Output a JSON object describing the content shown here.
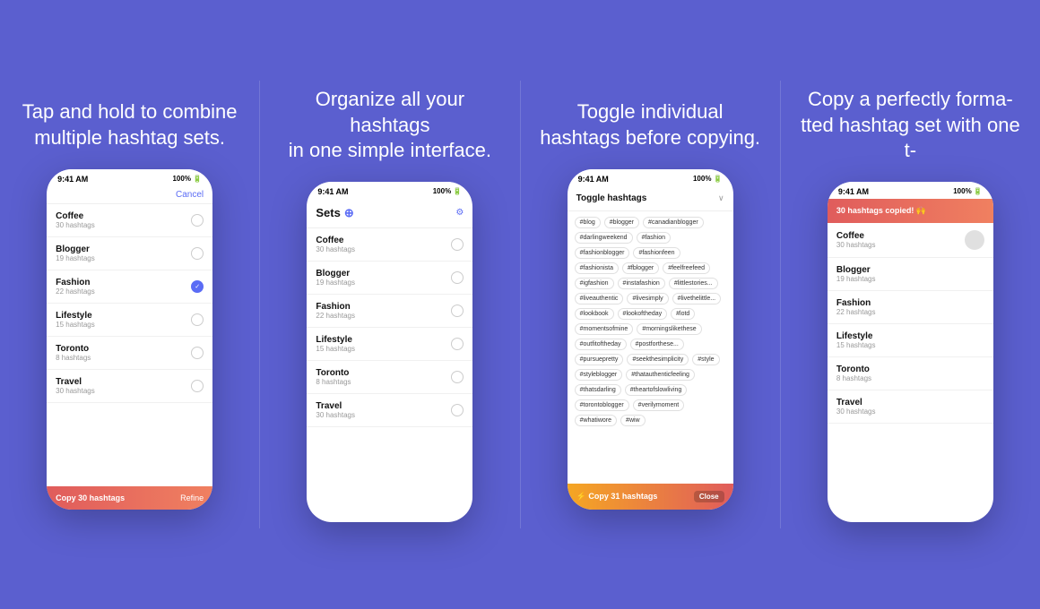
{
  "background_color": "#5b5fcf",
  "panels": [
    {
      "id": "panel-1",
      "description": "Tap and hold to combine multiple hashtag sets.",
      "phone": {
        "status_time": "9:41 AM",
        "status_battery": "100%",
        "header": {
          "cancel_label": "Cancel"
        },
        "list_items": [
          {
            "name": "Coffee",
            "count": "30 hashtags",
            "selected": false
          },
          {
            "name": "Blogger",
            "count": "19 hashtags",
            "selected": false
          },
          {
            "name": "Fashion",
            "count": "22 hashtags",
            "selected": true
          },
          {
            "name": "Lifestyle",
            "count": "15 hashtags",
            "selected": false
          },
          {
            "name": "Toronto",
            "count": "8 hashtags",
            "selected": false
          },
          {
            "name": "Travel",
            "count": "30 hashtags",
            "selected": false
          }
        ],
        "bottom_bar": {
          "left_label": "Copy 30 hashtags",
          "right_label": "Refine"
        }
      }
    },
    {
      "id": "panel-2",
      "description": "Organize all your hashtags in one simple interface.",
      "phone": {
        "status_time": "9:41 AM",
        "status_battery": "100%",
        "header": {
          "title": "Sets",
          "add_icon": "⊕",
          "settings_icon": "⚙"
        },
        "list_items": [
          {
            "name": "Coffee",
            "count": "30 hashtags"
          },
          {
            "name": "Blogger",
            "count": "19 hashtags"
          },
          {
            "name": "Fashion",
            "count": "22 hashtags"
          },
          {
            "name": "Lifestyle",
            "count": "15 hashtags"
          },
          {
            "name": "Toronto",
            "count": "8 hashtags"
          },
          {
            "name": "Travel",
            "count": "30 hashtags"
          }
        ]
      }
    },
    {
      "id": "panel-3",
      "description": "Toggle individual hashtags before copying.",
      "phone": {
        "status_time": "9:41 AM",
        "status_battery": "100%",
        "header": {
          "title": "Toggle hashtags"
        },
        "hashtags": [
          "#blog",
          "#blogger",
          "#canadianblogger",
          "#darlingweekend",
          "#fashion",
          "#fashionblogger",
          "#fashionfeen",
          "#fashionista",
          "#fblogger",
          "#feelfreefeed",
          "#igfashion",
          "#instafashion",
          "#littlestoriesofmylife",
          "#liveauthentic",
          "#livesimply",
          "#livethelittlethings",
          "#lookbook",
          "#lookoftheday",
          "#lotd",
          "#momentsofmine",
          "#morningslikethese",
          "#outfitoftheday",
          "#postforthesethetic",
          "#pursuepretty",
          "#seekthesimplicity",
          "#style",
          "#styleblogger",
          "#thatauthenticfeeling",
          "#thatsdarling",
          "#theartofslowliving",
          "#torontoblogger",
          "#verilymoment",
          "#whatiwore",
          "#wiw"
        ],
        "bottom_bar": {
          "left_label": "⚡ Copy 31 hashtags",
          "right_label": "Close"
        }
      }
    },
    {
      "id": "panel-4",
      "description": "Copy a perfectly formatted hashtag set with one tap.",
      "phone": {
        "status_time": "9:41 AM",
        "status_battery": "100%",
        "banner": "30 hashtags copied! 🙌",
        "list_items": [
          {
            "name": "Coffee",
            "count": "30 hashtags",
            "avatar": true
          },
          {
            "name": "Blogger",
            "count": "19 hashtags"
          },
          {
            "name": "Fashion",
            "count": "22 hashtags"
          },
          {
            "name": "Lifestyle",
            "count": "15 hashtags"
          },
          {
            "name": "Toronto",
            "count": "8 hashtags"
          },
          {
            "name": "Travel",
            "count": "30 hashtags"
          }
        ]
      }
    }
  ]
}
